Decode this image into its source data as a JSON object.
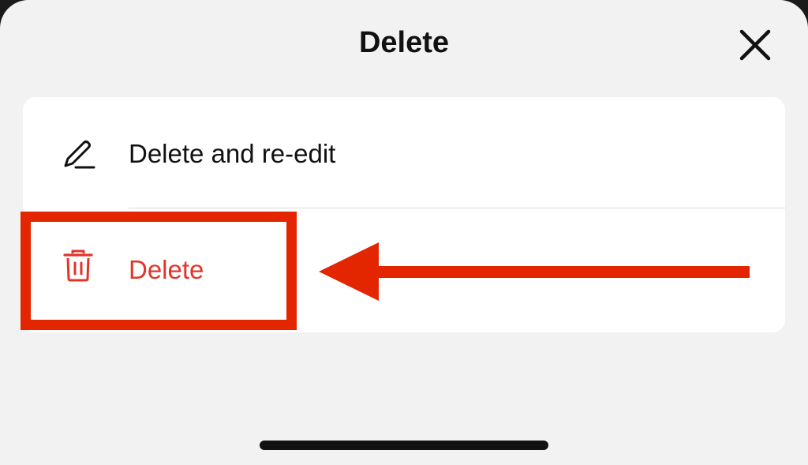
{
  "sheet": {
    "title": "Delete",
    "close_icon": "close-icon"
  },
  "options": [
    {
      "label": "Delete and re-edit",
      "icon": "pencil-icon",
      "color": "#111111"
    },
    {
      "label": "Delete",
      "icon": "trash-icon",
      "color": "#e0352b"
    }
  ],
  "annotation": {
    "highlight_color": "#e32600",
    "arrow_color": "#e32600"
  }
}
